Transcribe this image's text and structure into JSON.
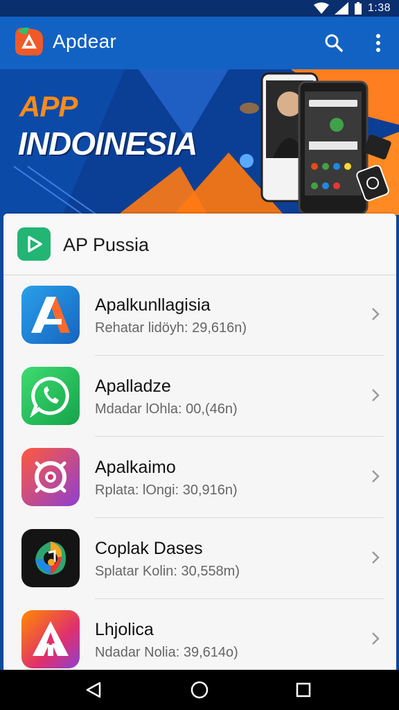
{
  "status_bar": {
    "time": "1:38"
  },
  "app_bar": {
    "title": "Apdear"
  },
  "banner": {
    "line1": "APP",
    "line2": "INDOINESIA"
  },
  "section": {
    "title": "AP Pussia"
  },
  "apps": [
    {
      "title": "Apalkunllagisia",
      "subtitle": "Rehatar lidöyh:  29,616n)",
      "icon": "a-logo-icon"
    },
    {
      "title": "Apalladze",
      "subtitle": "Mdadar lOhla:  00,(46n)",
      "icon": "phone-chat-icon"
    },
    {
      "title": "Apalkaimo",
      "subtitle": "Rplata: lOngi:  30,916n)",
      "icon": "target-icon"
    },
    {
      "title": "Coplak Dases",
      "subtitle": "Splatar Kolin:  30,558m)",
      "icon": "swirl-icon"
    },
    {
      "title": "Lhjolica",
      "subtitle": "Ndadar Nolia:  39,614o)",
      "icon": "a-outline-icon"
    }
  ],
  "colors": {
    "app_bar": "#1262c4",
    "status_bar": "#0a2f6e",
    "accent_orange": "#ff8c1a",
    "header_icon_green": "#22b573"
  }
}
